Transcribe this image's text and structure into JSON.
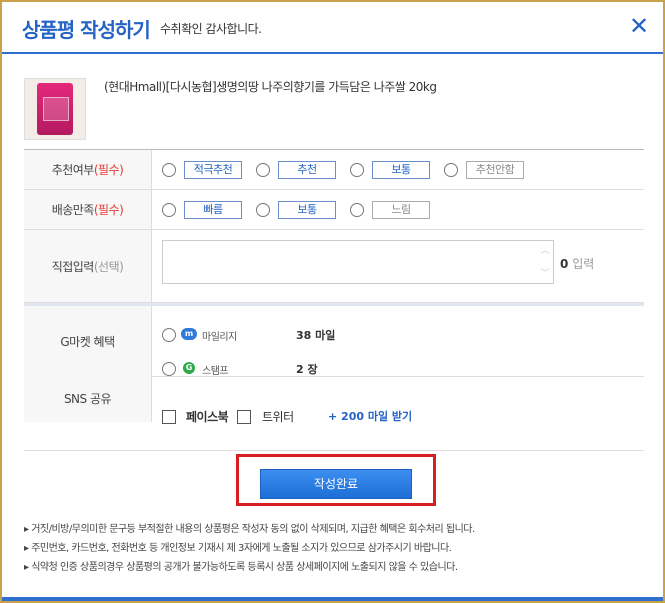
{
  "header": {
    "title": "상품평 작성하기",
    "subtitle": "수취확인 감사합니다.",
    "close_icon": "close-icon"
  },
  "product": {
    "name": "(현대Hmall)[다시농협]생명의땅 나주의향기를 가득담은 나주쌀 20kg"
  },
  "recommend": {
    "label": "추천여부",
    "required": "(필수)",
    "options": [
      "적극추천",
      "추천",
      "보통",
      "추천안함"
    ]
  },
  "delivery": {
    "label": "배송만족",
    "required": "(필수)",
    "options": [
      "빠름",
      "보통",
      "느림"
    ]
  },
  "direct": {
    "label": "직접입력",
    "optional": "(선택)",
    "count": "0",
    "count_unit": "입력"
  },
  "gmarket": {
    "label": "G마켓 혜택",
    "mileage_label": "마일리지",
    "mileage_value": "38 마일",
    "stamp_label": "스탬프",
    "stamp_value": "2 장"
  },
  "sns": {
    "label": "SNS 공유",
    "facebook": "페이스북",
    "twitter": "트위터",
    "bonus": "+ 200 마일 받기"
  },
  "submit_label": "작성완료",
  "notes": [
    "거짓/비방/무의미한 문구등 부적절한 내용의 상품평은 작성자 동의 없이 삭제되며, 지급한 혜택은 회수처리 됩니다.",
    "주민번호, 카드번호, 전화번호 등 개인정보 기재시 제 3자에게 노출될 소지가 있으므로 삼가주시기 바랍니다.",
    "식약청 인증 상품의경우 상품평의 공개가 불가능하도록 등록시 상품 상세페이지에 노출되지 않을 수 있습니다."
  ],
  "colors": {
    "accent": "#2563c4",
    "required": "#e53935",
    "highlight": "#d42020"
  }
}
